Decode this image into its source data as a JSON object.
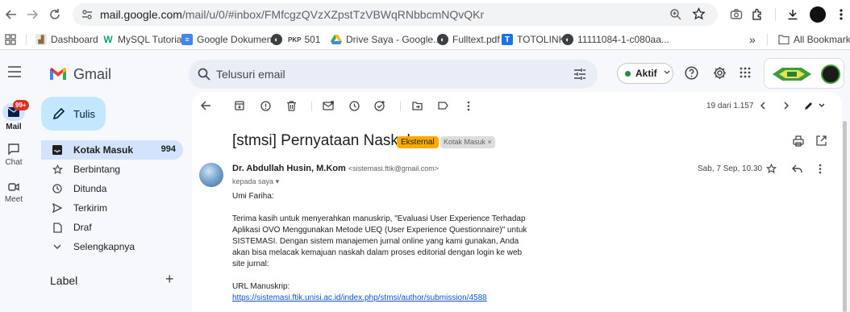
{
  "browser": {
    "url_host": "mail.google.com",
    "url_path": "/mail/u/0/#inbox/FMfcgzQVzXZpstTzVBWqRNbbcmNQvQKr",
    "bookmarks": [
      {
        "label": "Dashboard",
        "icon": "moodle-icon"
      },
      {
        "label": "MySQL Tutorial",
        "icon": "w3schools-icon"
      },
      {
        "label": "Google Dokumen",
        "icon": "docs-icon"
      },
      {
        "label": "PKP 501",
        "icon": "globe-icon"
      },
      {
        "label": "Drive Saya - Google...",
        "icon": "drive-icon"
      },
      {
        "label": "Fulltext.pdf",
        "icon": "globe-icon"
      },
      {
        "label": "TOTOLINK",
        "icon": "totolink-icon"
      },
      {
        "label": "11111084-1-c080aa...",
        "icon": "globe-icon"
      }
    ],
    "bookmark_pkp_badge": "PKP",
    "bookmark_pkp_label": "501",
    "totolink_badge": "T",
    "more_bookmarks": "»",
    "all_bookmarks_label": "All Bookmarks"
  },
  "gmail": {
    "logo_text": "Gmail",
    "search_placeholder": "Telusuri email",
    "status_label": "Aktif",
    "rail": {
      "mail_label": "Mail",
      "mail_badge": "99+",
      "chat_label": "Chat",
      "meet_label": "Meet"
    },
    "compose_label": "Tulis",
    "nav": [
      {
        "label": "Kotak Masuk",
        "count": "994",
        "icon": "inbox-icon",
        "active": true
      },
      {
        "label": "Berbintang",
        "count": "",
        "icon": "star-icon"
      },
      {
        "label": "Ditunda",
        "count": "",
        "icon": "clock-icon"
      },
      {
        "label": "Terkirim",
        "count": "",
        "icon": "send-icon"
      },
      {
        "label": "Draf",
        "count": "",
        "icon": "draft-icon"
      },
      {
        "label": "Selengkapnya",
        "count": "",
        "icon": "chevron-down-icon"
      }
    ],
    "labels_heading": "Label",
    "labels_add": "+"
  },
  "message": {
    "pagination": "19 dari 1.157",
    "subject": "[stmsi] Pernyataan Naskah",
    "chip_external": "Eksternal",
    "chip_inbox": "Kotak Masuk",
    "chip_inbox_close": "×",
    "sender_name": "Dr. Abdullah Husin, M.Kom",
    "sender_email": "<sistemasi.ftik@gmail.com>",
    "recipient": "kepada saya",
    "date": "Sab, 7 Sep, 10.30",
    "greeting": "Umi Fariha:",
    "body_lines": [
      "Terima kasih untuk menyerahkan manuskrip, \"Evaluasi User Experience Terhadap",
      "Aplikasi OVO Menggunakan Metode UEQ (User Experience Questionnaire)\" untuk",
      "SISTEMASI. Dengan sistem manajemen jurnal online yang kami gunakan, Anda",
      "akan bisa melacak kemajuan naskah dalam proses editorial dengan login ke web",
      "site jurnal:"
    ],
    "url_label": "URL Manuskrip:",
    "url_link": "https://sistemasi.ftik.unisi.ac.id/index.php/stmsi/author/submission/4588"
  },
  "colors": {
    "compose_bg": "#c2e7ff",
    "active_nav_bg": "#d3e3fd",
    "external_chip": "#f9ab00",
    "link": "#0b57d0",
    "badge_red": "#d93025"
  }
}
